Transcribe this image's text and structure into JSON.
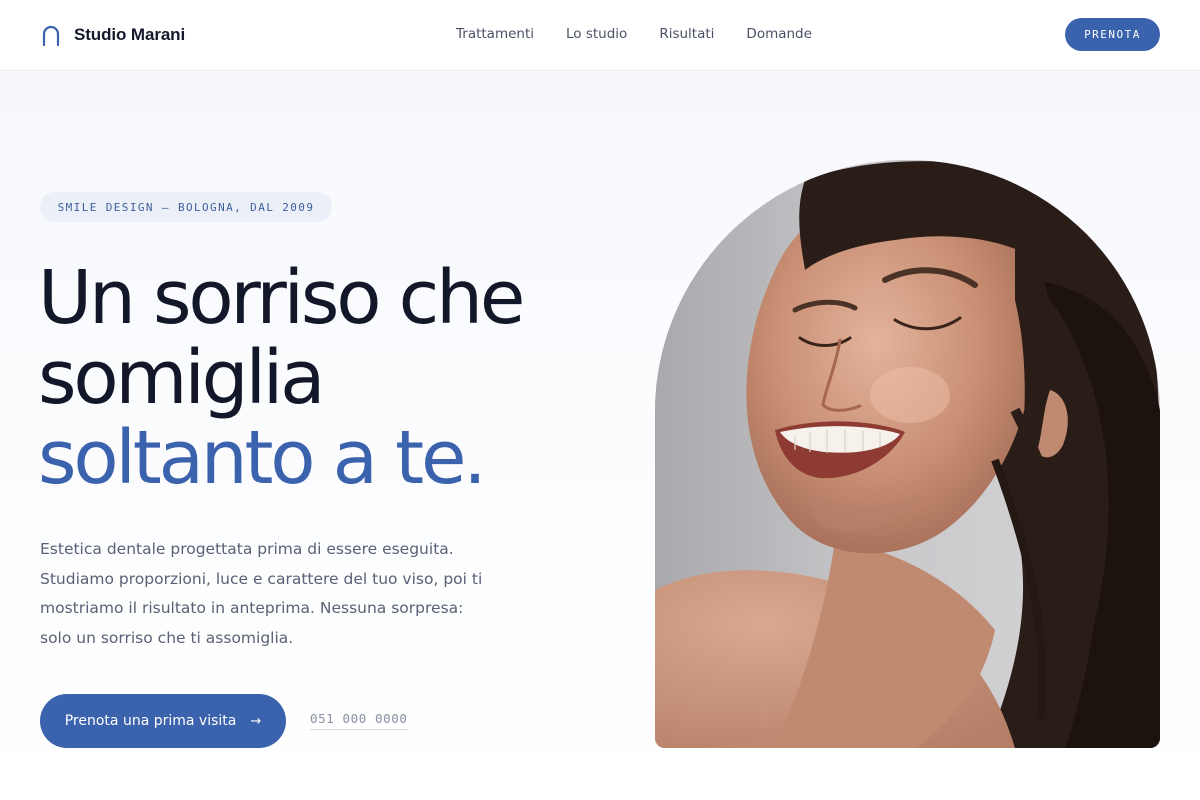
{
  "brand": {
    "name": "Studio Marani",
    "icon": "arch-icon"
  },
  "nav": {
    "items": [
      {
        "label": "Trattamenti"
      },
      {
        "label": "Lo studio"
      },
      {
        "label": "Risultati"
      },
      {
        "label": "Domande"
      }
    ],
    "cta_label": "PRENOTA"
  },
  "hero": {
    "eyebrow": "SMILE DESIGN — BOLOGNA, DAL 2009",
    "headline_line1": "Un sorriso che",
    "headline_line2": "somiglia",
    "headline_accent": "soltanto a te.",
    "lede_line1": "Estetica dentale progettata prima di essere eseguita.",
    "lede_line2": "Studiamo proporzioni, luce e carattere del tuo viso, poi ti",
    "lede_line3": "mostriamo il risultato in anteprima. Nessuna sorpresa:",
    "lede_line4": "solo un sorriso che ti assomiglia.",
    "cta_label": "Prenota una prima visita",
    "cta_arrow": "→",
    "phone": "051 000 0000"
  },
  "colors": {
    "accent": "#3a62ad",
    "text": "#121829",
    "muted": "#5a6175",
    "pill_bg": "#eaeff8"
  }
}
